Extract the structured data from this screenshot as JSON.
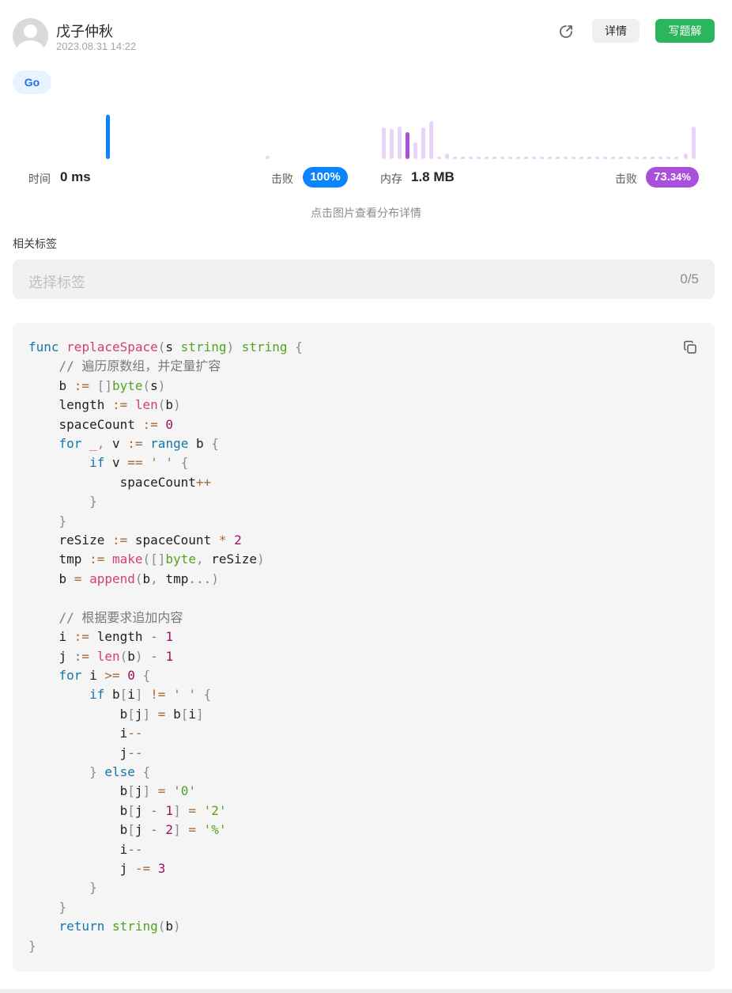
{
  "header": {
    "username": "戊子仲秋",
    "timestamp": "2023.08.31 14:22",
    "detail_label": "详情",
    "write_label": "写题解"
  },
  "language_tag": "Go",
  "stats": {
    "time_label": "时间",
    "time_value": "0 ms",
    "time_beat_label": "击败",
    "time_beat_value": "100%",
    "memory_label": "内存",
    "memory_value": "1.8 MB",
    "memory_beat_label": "击败",
    "memory_beat_int": "73.",
    "memory_beat_dec": "34%",
    "hint": "点击图片查看分布详情"
  },
  "tags": {
    "label": "相关标签",
    "placeholder": "选择标签",
    "count": "0/5"
  },
  "colors": {
    "accent_green": "#2db55d",
    "accent_blue": "#0a84ff",
    "accent_purple": "#a94fdb"
  },
  "code": {
    "language": "go",
    "lines": [
      "func replaceSpace(s string) string {",
      "    // 遍历原数组，并定量扩容",
      "    b := []byte(s)",
      "    length := len(b)",
      "    spaceCount := 0",
      "    for _, v := range b {",
      "        if v == ' ' {",
      "            spaceCount++",
      "        }",
      "    }",
      "    reSize := spaceCount * 2",
      "    tmp := make([]byte, reSize)",
      "    b = append(b, tmp...)",
      "",
      "    // 根据要求追加内容",
      "    i := length - 1",
      "    j := len(b) - 1",
      "    for i >= 0 {",
      "        if b[i] != ' ' {",
      "            b[j] = b[i]",
      "            i--",
      "            j--",
      "        } else {",
      "            b[j] = '0'",
      "            b[j - 1] = '2'",
      "            b[j - 2] = '%'",
      "            i--",
      "            j -= 3",
      "        }",
      "    }",
      "    return string(b)",
      "}"
    ]
  }
}
